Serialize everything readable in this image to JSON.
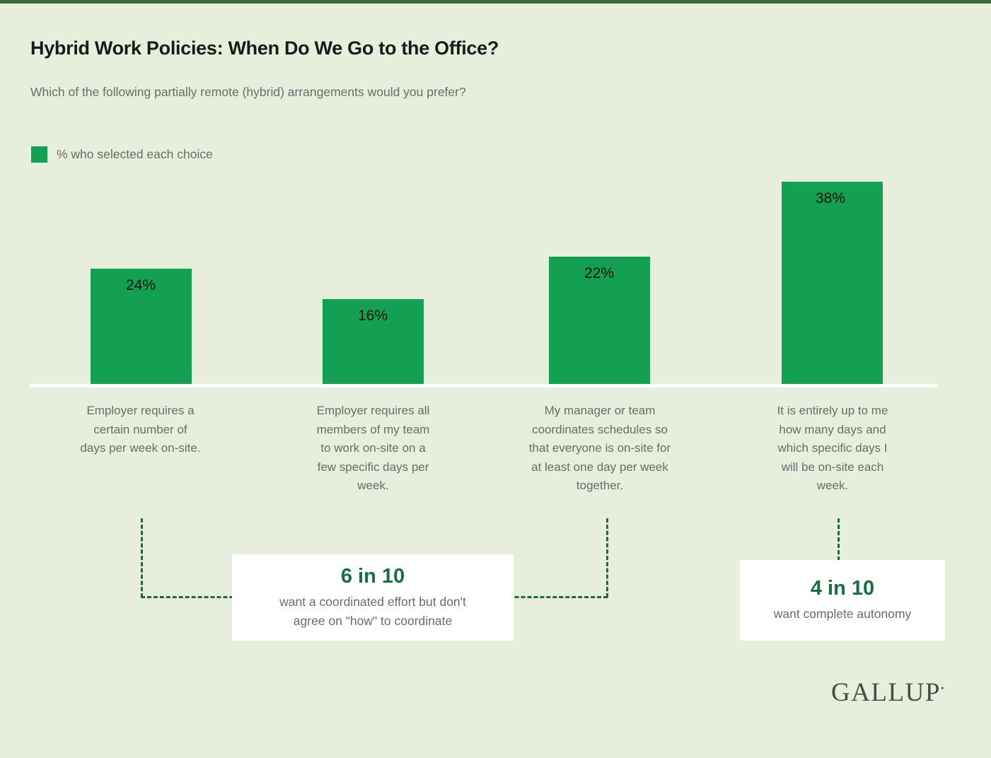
{
  "page": {
    "background_color": "#e7eedb",
    "top_rule_color": "#3d6b3d",
    "brand": "GALLUP",
    "brand_mark": "•"
  },
  "header": {
    "title": "Hybrid Work Policies: When Do We Go to the Office?",
    "subtitle": "Which of the following partially remote (hybrid) arrangements would you prefer?"
  },
  "legend": {
    "label": "% who selected each choice",
    "swatch_color": "#14a053"
  },
  "chart_data": {
    "type": "bar",
    "title": "Hybrid Work Policies: When Do We Go to the Office?",
    "subtitle": "Which of the following partially remote (hybrid) arrangements would you prefer?",
    "xlabel": "",
    "ylabel": "",
    "ylim": [
      0,
      45
    ],
    "grid": false,
    "legend_position": "top-left",
    "series": [
      {
        "name": "% who selected each choice",
        "color": "#14a053",
        "values": [
          24,
          16,
          22,
          38
        ]
      }
    ],
    "categories": [
      "Employer requires a certain number of days per week on-site.",
      "Employer requires all members of my team to work on-site on a few specific days per week.",
      "My manager or team coordinates schedules so that everyone is on-site for at least one day per week together.",
      "It is entirely up to me how many days and which specific days I will be on-site each week."
    ],
    "data_labels": [
      "24%",
      "16%",
      "22%",
      "38%"
    ],
    "annotations": [
      {
        "headline": "6 in 10",
        "body": "want a coordinated effort but don't agree on \"how\" to coordinate",
        "covers_categories": [
          0,
          1,
          2
        ]
      },
      {
        "headline": "4 in 10",
        "body": "want complete autonomy",
        "covers_categories": [
          3
        ]
      }
    ]
  },
  "bars": [
    {
      "label_lines": [
        "Employer requires a",
        "certain number of",
        "days per week on-site."
      ],
      "value_text": "24%"
    },
    {
      "label_lines": [
        "Employer requires all",
        "members of my team",
        "to work on-site on a",
        "few specific days per",
        "week."
      ],
      "value_text": "16%"
    },
    {
      "label_lines": [
        "My manager or team",
        "coordinates schedules so",
        "that everyone is on-site for",
        "at least one day per week",
        "together."
      ],
      "value_text": "22%"
    },
    {
      "label_lines": [
        "It is entirely up to me",
        "how many days and",
        "which specific days I",
        "will be on-site each",
        "week."
      ],
      "value_text": "38%"
    }
  ],
  "callouts": {
    "coordinated": {
      "headline": "6 in 10",
      "line1": "want a coordinated effort but don't",
      "line2": "agree on \"how\" to coordinate"
    },
    "autonomy": {
      "headline": "4 in 10",
      "line1": "want complete autonomy"
    }
  }
}
